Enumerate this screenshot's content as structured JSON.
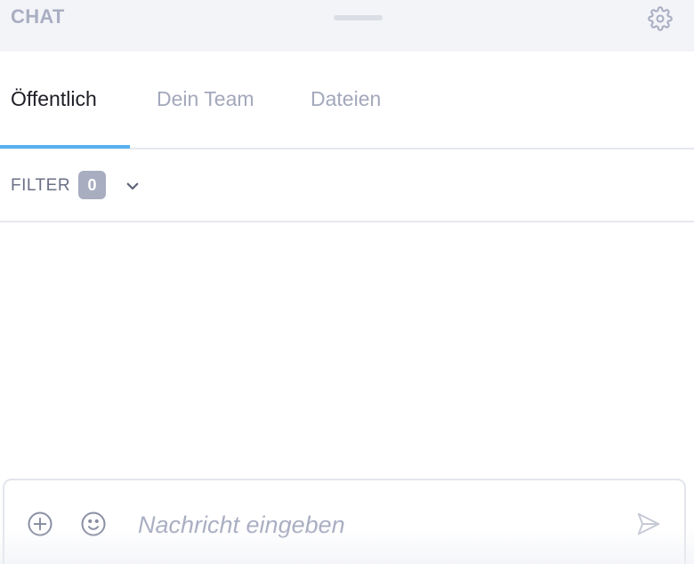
{
  "header": {
    "title": "CHAT",
    "settings_icon": "gear-icon"
  },
  "tabs": [
    {
      "label": "Öffentlich",
      "active": true
    },
    {
      "label": "Dein Team",
      "active": false
    },
    {
      "label": "Dateien",
      "active": false
    }
  ],
  "filter": {
    "label": "FILTER",
    "count": "0",
    "toggle_icon": "chevron-down-icon"
  },
  "composer": {
    "placeholder": "Nachricht eingeben",
    "value": "",
    "icons": [
      "add-circle-icon",
      "emoji-icon",
      "send-icon"
    ]
  },
  "colors": {
    "accent": "#58b2f0",
    "muted_text": "#a3a8bb",
    "header_bg": "#f3f4f8",
    "badge_bg": "#a8adc0"
  }
}
